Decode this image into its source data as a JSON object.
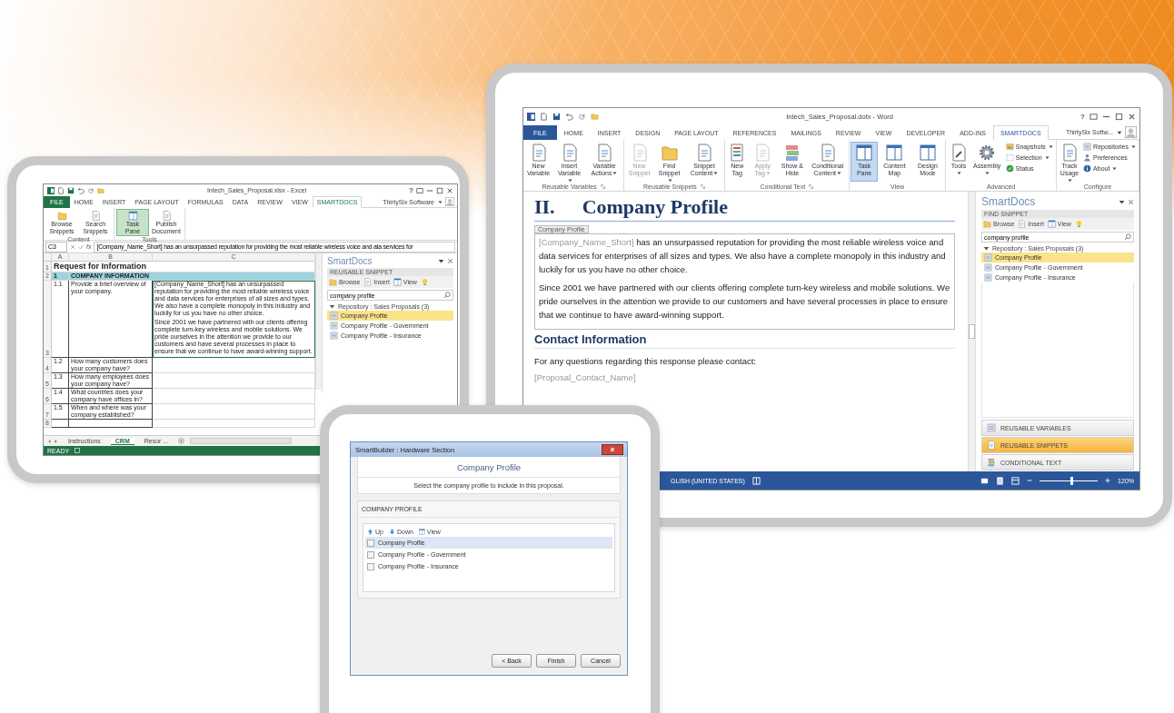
{
  "excel": {
    "title": "Intech_Sales_Proposal.xlsx - Excel",
    "help": "?",
    "tabs": [
      {
        "label": "FILE",
        "kind": "file",
        "selected": false
      },
      {
        "label": "HOME",
        "kind": "tab",
        "selected": false
      },
      {
        "label": "INSERT",
        "kind": "tab",
        "selected": false
      },
      {
        "label": "PAGE LAYOUT",
        "kind": "tab",
        "selected": false
      },
      {
        "label": "FORMULAS",
        "kind": "tab",
        "selected": false
      },
      {
        "label": "DATA",
        "kind": "tab",
        "selected": false
      },
      {
        "label": "REVIEW",
        "kind": "tab",
        "selected": false
      },
      {
        "label": "VIEW",
        "kind": "tab",
        "selected": false
      },
      {
        "label": "SMARTDOCS",
        "kind": "tab",
        "selected": true
      }
    ],
    "account": "ThirtySix Software",
    "ribbon_groups": [
      {
        "name": "Content",
        "buttons": [
          {
            "label": "Browse Snippets",
            "selected": false
          },
          {
            "label": "Search Snippets",
            "selected": false
          }
        ]
      },
      {
        "name": "Tools",
        "buttons": [
          {
            "label": "Task Pane",
            "selected": true
          },
          {
            "label": "Publish Document",
            "selected": false
          }
        ]
      }
    ],
    "name_box": "C3",
    "fx": "fx",
    "formula": "[Company_Name_Short] has an unsurpassed reputation for providing the most reliable wireless voice and ata services for",
    "columns": [
      "A",
      "B",
      "C"
    ],
    "rows": [
      {
        "number": "1",
        "kind": "title",
        "cells": [
          "Request for Information"
        ]
      },
      {
        "number": "2",
        "kind": "section",
        "cells": [
          "1",
          "COMPANY INFORMATION"
        ]
      },
      {
        "number": "3",
        "kind": "item",
        "cells": [
          "1.1",
          "Provide a brief overview of your company."
        ],
        "answer": [
          "[Company_Name_Short] has an unsurpassed reputation for providing the most reliable wireless voice and data services for enterprises of all sizes and types. We also have a complete monopoly in this industry and luckily for us you have no other choice.",
          "Since 2001 we have partnered with our clients offering complete turn-key wireless and mobile solutions. We pride ourselves in the attention we provide to our customers and have several processes in place to ensure that we continue to have award-winning support."
        ]
      },
      {
        "number": "4",
        "kind": "item",
        "cells": [
          "1.2",
          "How many customers does your company have?"
        ]
      },
      {
        "number": "5",
        "kind": "item",
        "cells": [
          "1.3",
          "How many employees does your company have?"
        ]
      },
      {
        "number": "6",
        "kind": "item",
        "cells": [
          "1.4",
          "What countries does your company have offices in?"
        ]
      },
      {
        "number": "7",
        "kind": "item",
        "cells": [
          "1.5",
          "When and where was your company established?"
        ]
      },
      {
        "number": "8",
        "kind": "item",
        "cells": []
      }
    ],
    "pane": {
      "title": "SmartDocs",
      "section": "REUSABLE SNIPPET",
      "tools": [
        "Browse",
        "Insert",
        "View"
      ],
      "search": "company profile",
      "repository": "Repository : Sales Proposals (3)",
      "expanded": true,
      "items": [
        {
          "label": "Company Profile",
          "selected": true
        },
        {
          "label": "Company Profile - Government",
          "selected": false
        },
        {
          "label": "Company Profile - Insurance",
          "selected": false
        }
      ]
    },
    "sheets": [
      {
        "label": "Instructions",
        "selected": false
      },
      {
        "label": "CRM",
        "selected": true
      },
      {
        "label": "Resor ...",
        "selected": false
      }
    ],
    "status": "READY"
  },
  "word": {
    "title": "Intech_Sales_Proposal.dotx - Word",
    "help": "?",
    "tabs": [
      {
        "label": "FILE",
        "kind": "file",
        "selected": false
      },
      {
        "label": "HOME",
        "kind": "tab",
        "selected": false
      },
      {
        "label": "INSERT",
        "kind": "tab",
        "selected": false
      },
      {
        "label": "DESIGN",
        "kind": "tab",
        "selected": false
      },
      {
        "label": "PAGE LAYOUT",
        "kind": "tab",
        "selected": false
      },
      {
        "label": "REFERENCES",
        "kind": "tab",
        "selected": false
      },
      {
        "label": "MAILINGS",
        "kind": "tab",
        "selected": false
      },
      {
        "label": "REVIEW",
        "kind": "tab",
        "selected": false
      },
      {
        "label": "VIEW",
        "kind": "tab",
        "selected": false
      },
      {
        "label": "DEVELOPER",
        "kind": "tab",
        "selected": false
      },
      {
        "label": "ADD-INS",
        "kind": "tab",
        "selected": false
      },
      {
        "label": "SMARTDOCS",
        "kind": "tab",
        "selected": true
      }
    ],
    "account": "ThirtySix Softw...",
    "ribbon_groups": [
      {
        "name": "Reusable Variables",
        "launcher": true,
        "buttons": [
          {
            "label": "New Variable",
            "kind": "large",
            "dropdown": false,
            "disabled": false,
            "selected": false
          },
          {
            "label": "Insert Variable",
            "kind": "large",
            "dropdown": true,
            "disabled": false,
            "selected": false
          },
          {
            "label": "Variable Actions",
            "kind": "large",
            "dropdown": true,
            "disabled": false,
            "selected": false
          }
        ]
      },
      {
        "name": "Reusable Snippets",
        "launcher": true,
        "buttons": [
          {
            "label": "New Snippet",
            "kind": "large",
            "dropdown": false,
            "disabled": true,
            "selected": false
          },
          {
            "label": "Find Snippet",
            "kind": "large",
            "dropdown": true,
            "disabled": false,
            "selected": false
          },
          {
            "label": "Snippet Content",
            "kind": "large",
            "dropdown": true,
            "disabled": false,
            "selected": false
          }
        ]
      },
      {
        "name": "Conditional Text",
        "launcher": true,
        "buttons": [
          {
            "label": "New Tag",
            "kind": "large",
            "dropdown": false,
            "disabled": false,
            "selected": false
          },
          {
            "label": "Apply Tag",
            "kind": "large",
            "dropdown": true,
            "disabled": true,
            "selected": false
          },
          {
            "label": "Show & Hide",
            "kind": "large",
            "dropdown": false,
            "disabled": false,
            "selected": false
          },
          {
            "label": "Conditional Content",
            "kind": "large",
            "dropdown": true,
            "disabled": false,
            "selected": false
          }
        ]
      },
      {
        "name": "View",
        "launcher": false,
        "buttons": [
          {
            "label": "Task Pane",
            "kind": "large",
            "dropdown": false,
            "disabled": false,
            "selected": true
          },
          {
            "label": "Content Map",
            "kind": "large",
            "dropdown": false,
            "disabled": false,
            "selected": false
          },
          {
            "label": "Design Mode",
            "kind": "large",
            "dropdown": false,
            "disabled": false,
            "selected": false
          }
        ]
      },
      {
        "name": "Advanced",
        "launcher": false,
        "buttons": [
          {
            "label": "Tools",
            "kind": "large",
            "dropdown": true,
            "disabled": false,
            "selected": false
          },
          {
            "label": "Assembly",
            "kind": "large",
            "dropdown": true,
            "disabled": false,
            "selected": false
          },
          {
            "label": "Snapshots",
            "kind": "small",
            "dropdown": true,
            "disabled": false,
            "selected": false
          },
          {
            "label": "Selection",
            "kind": "small",
            "dropdown": true,
            "disabled": false,
            "selected": false
          },
          {
            "label": "Status",
            "kind": "small",
            "dropdown": false,
            "disabled": false,
            "selected": false
          }
        ]
      },
      {
        "name": "Configure",
        "launcher": false,
        "buttons": [
          {
            "label": "Track Usage",
            "kind": "large",
            "dropdown": true,
            "disabled": false,
            "selected": false
          },
          {
            "label": "Repositories",
            "kind": "small",
            "dropdown": true,
            "disabled": false,
            "selected": false
          },
          {
            "label": "Preferences",
            "kind": "small",
            "dropdown": false,
            "disabled": false,
            "selected": false
          },
          {
            "label": "About",
            "kind": "small",
            "dropdown": true,
            "disabled": false,
            "selected": false
          }
        ]
      }
    ],
    "document": {
      "number": "II.",
      "heading": "Company Profile",
      "control_tag": "Company Profile",
      "paragraphs": [
        {
          "placeholder": "[Company_Name_Short]",
          "text": " has an unsurpassed reputation for providing the most reliable wireless voice and data services for enterprises of all sizes and types. We also have a complete monopoly in this industry and luckily for us you have no other choice."
        },
        {
          "text": "Since 2001 we have partnered with our clients offering complete turn-key wireless and mobile solutions. We pride ourselves in the attention we provide to our customers and have several processes in place to ensure that we continue to have award-winning support."
        }
      ],
      "subheading": "Contact Information",
      "contact_text": "For any questions regarding this response please contact:",
      "contact_placeholder": "[Proposal_Contact_Name]"
    },
    "pane": {
      "title": "SmartDocs",
      "section": "FIND SNIPPET",
      "tools": [
        "Browse",
        "Insert",
        "View"
      ],
      "search": "company profile",
      "repository": "Repository : Sales Proposals (3)",
      "expanded": true,
      "items": [
        {
          "label": "Company Profile",
          "selected": true
        },
        {
          "label": "Company Profile - Government",
          "selected": false
        },
        {
          "label": "Company Profile - Insurance",
          "selected": false
        }
      ],
      "nav": [
        {
          "label": "REUSABLE VARIABLES",
          "selected": false
        },
        {
          "label": "REUSABLE SNIPPETS",
          "selected": true
        },
        {
          "label": "CONDITIONAL TEXT",
          "selected": false
        }
      ]
    },
    "status_bar": {
      "language": "GLISH (UNITED STATES)",
      "zoom": {
        "level": 0.55,
        "reading": "120%"
      }
    }
  },
  "dialog": {
    "title": "SmartBuilder : Hardware Section",
    "heading": "Company Profile",
    "instruction": "Select the company profile to include in this proposal.",
    "group": "COMPANY PROFILE",
    "tools": [
      "Up",
      "Down",
      "View"
    ],
    "items": [
      {
        "label": "Company Profile",
        "checked": false,
        "selected": true
      },
      {
        "label": "Company Profile - Government",
        "checked": false,
        "selected": false
      },
      {
        "label": "Company Profile - Insurance",
        "checked": false,
        "selected": false
      }
    ],
    "buttons": [
      "< Back",
      "Finish",
      "Cancel"
    ]
  }
}
